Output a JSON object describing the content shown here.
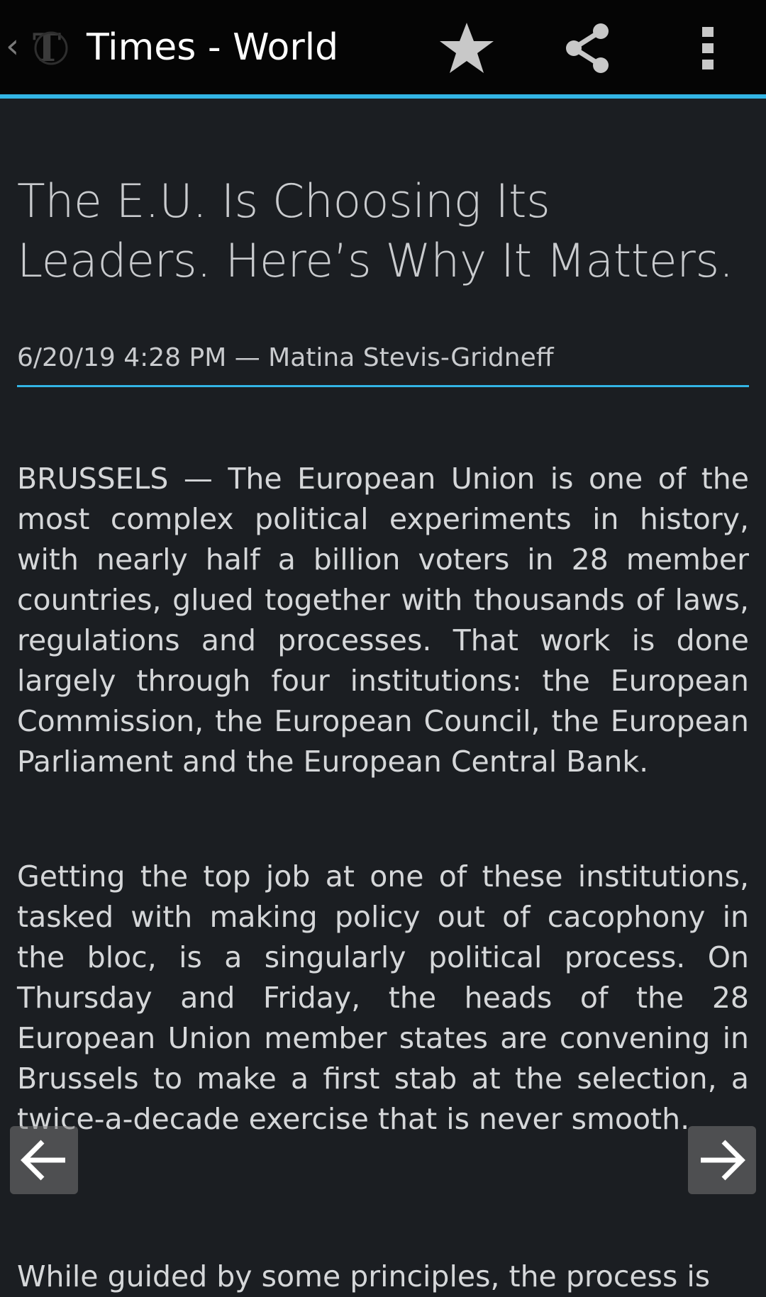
{
  "appbar": {
    "title": "Times - World",
    "icons": [
      "back-chevron-icon",
      "nyt-logo-icon",
      "star-icon",
      "share-icon",
      "overflow-menu-icon"
    ]
  },
  "article": {
    "headline": "The E.U. Is Choosing Its Leaders. Here’s Why It Matters.",
    "byline": "6/20/19 4:28 PM — Matina Stevis-Gridneff",
    "paragraphs": [
      "BRUSSELS — The European Union is one of the most complex political experiments in history, with nearly half a billion voters in 28 member countries, glued together with thousands of laws, regulations and processes. That work is done largely through four institutions: the European Commission, the European Council, the European Parliament and the European Central Bank.",
      "Getting the top job at one of these institutions, tasked with making policy out of cacophony in the bloc, is a singularly political process. On Thursday and Friday, the heads of the 28 European Union member states are convening in Brussels to make a first stab at the selection, a twice-a-decade exercise that is never smooth.",
      "While guided by some principles, the process is"
    ]
  },
  "nav": {
    "prev_icon": "arrow-left-icon",
    "next_icon": "arrow-right-icon"
  },
  "colors": {
    "accent": "#33b5e5",
    "appbar_bg": "#050505",
    "page_bg": "#1b1e22"
  }
}
